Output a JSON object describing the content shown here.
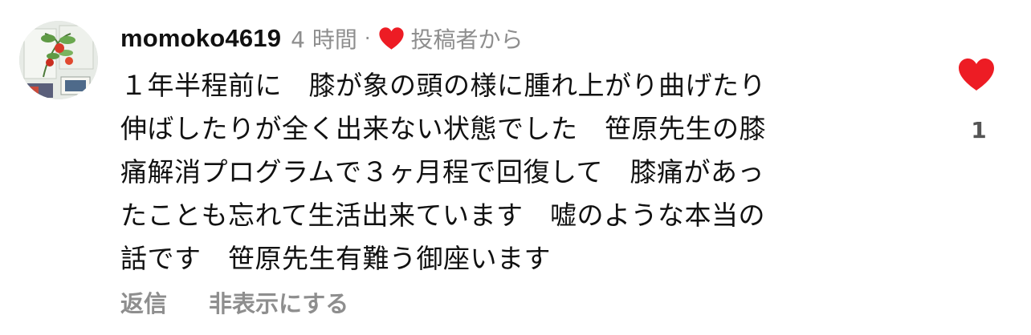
{
  "colors": {
    "heart": "#ed1c24",
    "meta_text": "#8e8e8e",
    "body_text": "#111111"
  },
  "comment": {
    "avatar_icon": "avatar-photo",
    "username": "momoko4619",
    "time_ago": "4 時間",
    "separator": "·",
    "liked_icon": "heart-icon",
    "liked_by_author": "投稿者から",
    "text": "１年半程前に　膝が象の頭の様に腫れ上がり曲げたり\n伸ばしたりが全く出来ない状態でした　笹原先生の膝\n痛解消プログラムで３ヶ月程で回復して　膝痛があっ\nたことも忘れて生活出来ています　嘘のような本当の\n話です　笹原先生有難う御座います",
    "like_count": "1"
  },
  "actions": {
    "reply": "返信",
    "hide": "非表示にする"
  }
}
